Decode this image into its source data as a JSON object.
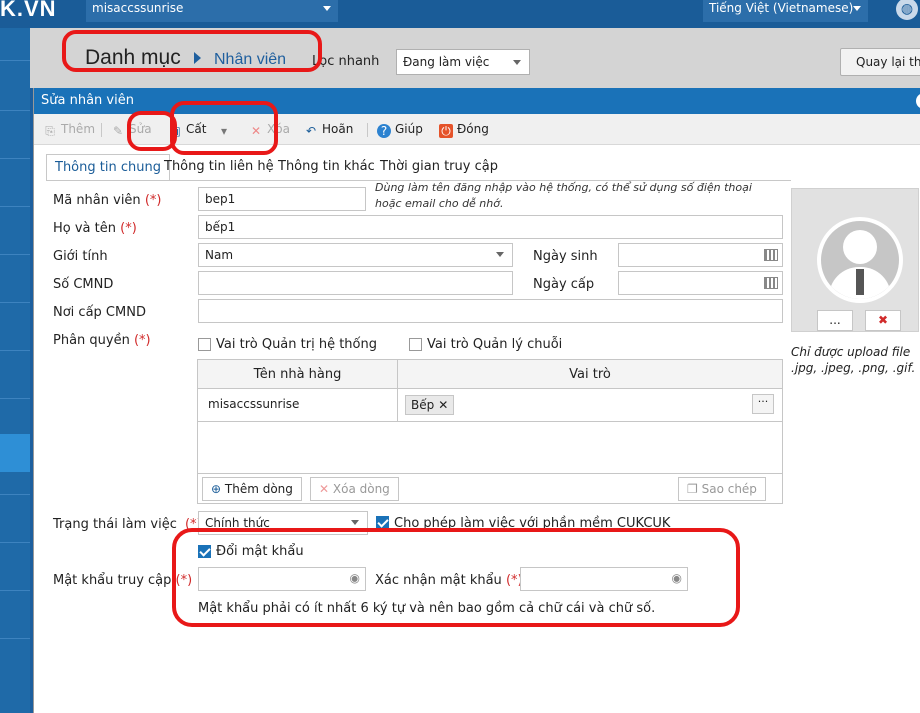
{
  "app": {
    "logo_text": "K.VN",
    "tenant": "misaccssunrise",
    "language": "Tiếng Việt (Vietnamese)"
  },
  "header": {
    "breadcrumb_root": "Danh mục",
    "breadcrumb_current": "Nhân viên",
    "quick_filter_label": "Lọc nhanh",
    "status_filter": "Đang làm việc",
    "back_button": "Quay lại thiết lập"
  },
  "dialog": {
    "title": "Sửa nhân viên",
    "toolbar": {
      "add": "Thêm",
      "edit": "Sửa",
      "save": "Cất",
      "delete": "Xóa",
      "undo": "Hoãn",
      "help": "Giúp",
      "close": "Đóng"
    },
    "tabs": [
      "Thông tin chung",
      "Thông tin liên hệ",
      "Thông tin khác",
      "Thời gian truy cập"
    ],
    "form": {
      "employee_code_label": "Mã nhân viên",
      "employee_code_value": "bep1",
      "employee_code_hint": "Dùng làm tên đăng nhập vào hệ thống, có thể sử dụng số điện thoại hoặc email cho dễ nhớ.",
      "full_name_label": "Họ và tên",
      "full_name_value": "bếp1",
      "gender_label": "Giới tính",
      "gender_value": "Nam",
      "birthday_label": "Ngày sinh",
      "id_card_label": "Số CMND",
      "issue_date_label": "Ngày cấp",
      "issue_place_label": "Nơi cấp CMND",
      "permission_label": "Phân quyền",
      "role_system_admin": "Vai trò Quản trị hệ thống",
      "role_chain_manager": "Vai trò Quản lý chuỗi",
      "required_mark": "(*)",
      "work_status_label": "Trạng thái làm việc",
      "work_status_value": "Chính thức",
      "allow_cukcuk": "Cho phép làm việc với phần mềm CUKCUK",
      "change_password": "Đổi mật khẩu",
      "password_label": "Mật khẩu truy cập",
      "confirm_password_label": "Xác nhận mật khẩu",
      "password_hint": "Mật khẩu phải có ít nhất 6 ký tự và nên bao gồm cả chữ cái và chữ số."
    },
    "grid": {
      "col_restaurant": "Tên nhà hàng",
      "col_role": "Vai trò",
      "rows": [
        {
          "restaurant": "misaccssunrise",
          "role": "Bếp"
        }
      ],
      "add_row": "Thêm dòng",
      "delete_row": "Xóa dòng",
      "copy": "Sao chép"
    },
    "avatar": {
      "browse": "...",
      "remove": "✖",
      "note_line1": "Chỉ được upload file",
      "note_line2": ".jpg, .jpeg, .png, .gif."
    }
  },
  "colors": {
    "brand_blue": "#1a5c98",
    "dialog_title_bg": "#1a72b8",
    "required_red": "#d12b2b",
    "annotation_red": "#e81818"
  }
}
